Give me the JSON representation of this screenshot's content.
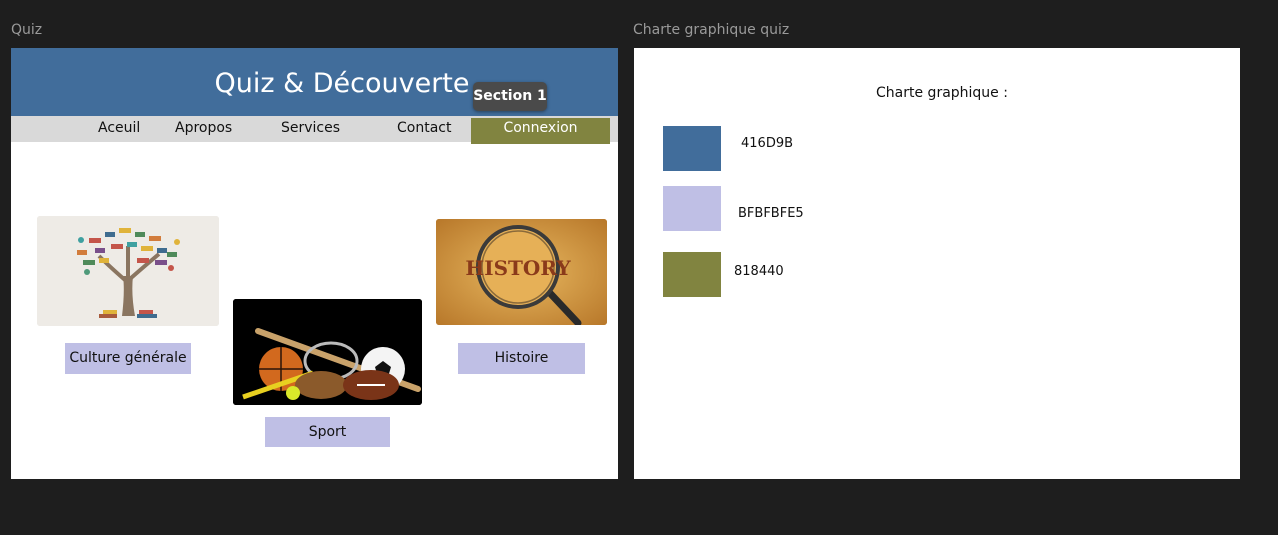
{
  "canvas": {
    "frame_quiz_label": "Quiz",
    "frame_charte_label": "Charte graphique quiz"
  },
  "quiz": {
    "title": "Quiz & Découverte",
    "section_tag": "Section 1",
    "nav": {
      "items": [
        "Aceuil",
        "Apropos",
        "Services",
        "Contact"
      ],
      "connexion": "Connexion"
    },
    "cards": {
      "culture": "Culture générale",
      "sport": "Sport",
      "histoire": "Histoire"
    },
    "history_image_text": "HISTORY"
  },
  "charte": {
    "title": "Charte graphique :",
    "swatches": [
      {
        "label": "416D9B",
        "color": "#416D9B"
      },
      {
        "label": "BFBFBFE5",
        "color": "#BFBFE5"
      },
      {
        "label": "818440",
        "color": "#818440"
      }
    ]
  },
  "colors": {
    "primary": "#416D9B",
    "secondary": "#BFBFE5",
    "accent": "#818440",
    "canvas_bg": "#1e1e1e",
    "nav_bg": "#d9d9d9"
  }
}
